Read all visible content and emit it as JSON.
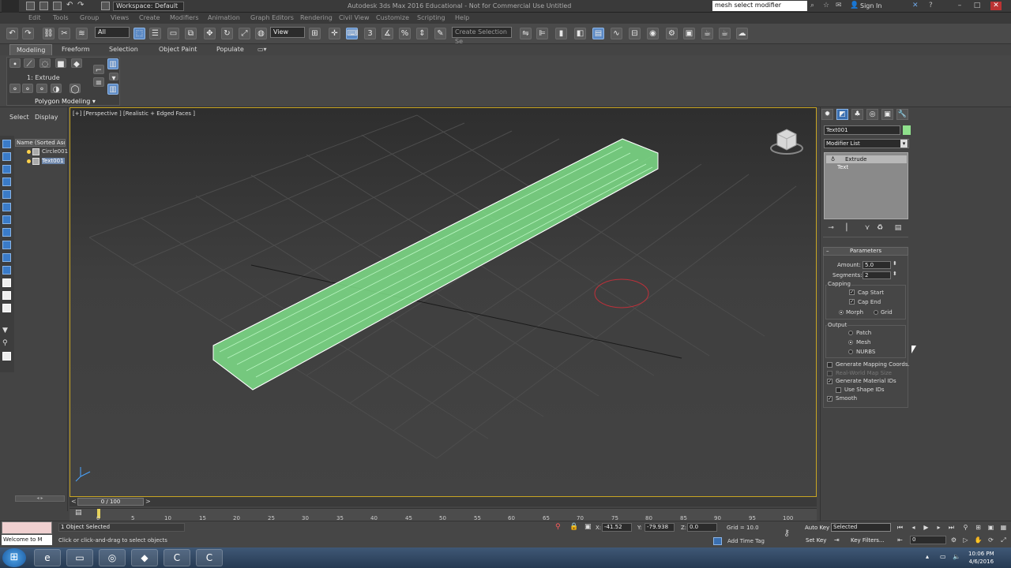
{
  "window": {
    "title": "Autodesk 3ds Max 2016  Educational - Not for Commercial Use   Untitled",
    "workspace": "Workspace: Default",
    "search_value": "mesh select modifier",
    "sign_in": "Sign In",
    "logo": "MAX"
  },
  "menu": [
    "Edit",
    "Tools",
    "Group",
    "Views",
    "Create",
    "Modifiers",
    "Animation",
    "Graph Editors",
    "Rendering",
    "Civil View",
    "Customize",
    "Scripting",
    "Help"
  ],
  "toolbar": {
    "filter_value": "All",
    "refcoord_value": "View",
    "named_selection_placeholder": "Create Selection Se"
  },
  "ribbon": {
    "tabs": [
      "Modeling",
      "Freeform",
      "Selection",
      "Object Paint",
      "Populate"
    ],
    "active_tab": "Modeling",
    "panel_label": "1: Extrude",
    "panel_title": "Polygon Modeling"
  },
  "explorer": {
    "tabs": [
      "Select",
      "Display"
    ],
    "header": "Name (Sorted Ascen",
    "items": [
      {
        "label": "Circle001",
        "selected": false
      },
      {
        "label": "Text001",
        "selected": true
      }
    ]
  },
  "viewport": {
    "label": "[+] [Perspective ] [Realistic + Edged Faces ]"
  },
  "command_panel": {
    "object_name": "Text001",
    "object_color": "#8fe08c",
    "modifier_list": "Modifier List",
    "stack": [
      "Extrude",
      "Text"
    ],
    "parameters": {
      "title": "Parameters",
      "amount_label": "Amount:",
      "amount_value": "5.0",
      "segments_label": "Segments:",
      "segments_value": "2",
      "capping_label": "Capping",
      "cap_start": "Cap Start",
      "cap_end": "Cap End",
      "morph": "Morph",
      "grid": "Grid",
      "output_label": "Output",
      "patch": "Patch",
      "mesh": "Mesh",
      "nurbs": "NURBS",
      "gen_mapping": "Generate Mapping Coords.",
      "real_world": "Real-World Map Size",
      "gen_material": "Generate Material IDs",
      "use_shape": "Use Shape IDs",
      "smooth": "Smooth"
    }
  },
  "timeline": {
    "slider": "0 / 100",
    "ticks": [
      "0",
      "5",
      "10",
      "15",
      "20",
      "25",
      "30",
      "35",
      "40",
      "45",
      "50",
      "55",
      "60",
      "65",
      "70",
      "75",
      "80",
      "85",
      "90",
      "95",
      "100"
    ]
  },
  "status": {
    "welcome": "Welcome to M",
    "selected": "1 Object Selected",
    "prompt": "Click or click-and-drag to select objects",
    "x_label": "X:",
    "x_value": "-41.52",
    "y_label": "Y:",
    "y_value": "-79.938",
    "z_label": "Z:",
    "z_value": "0.0",
    "grid": "Grid = 10.0",
    "add_time_tag": "Add Time Tag",
    "auto_key": "Auto Key",
    "set_key": "Set Key",
    "selected_combo": "Selected",
    "key_filters": "Key Filters...",
    "frame": "0"
  },
  "taskbar": {
    "time": "10:06 PM",
    "date": "4/6/2016"
  }
}
